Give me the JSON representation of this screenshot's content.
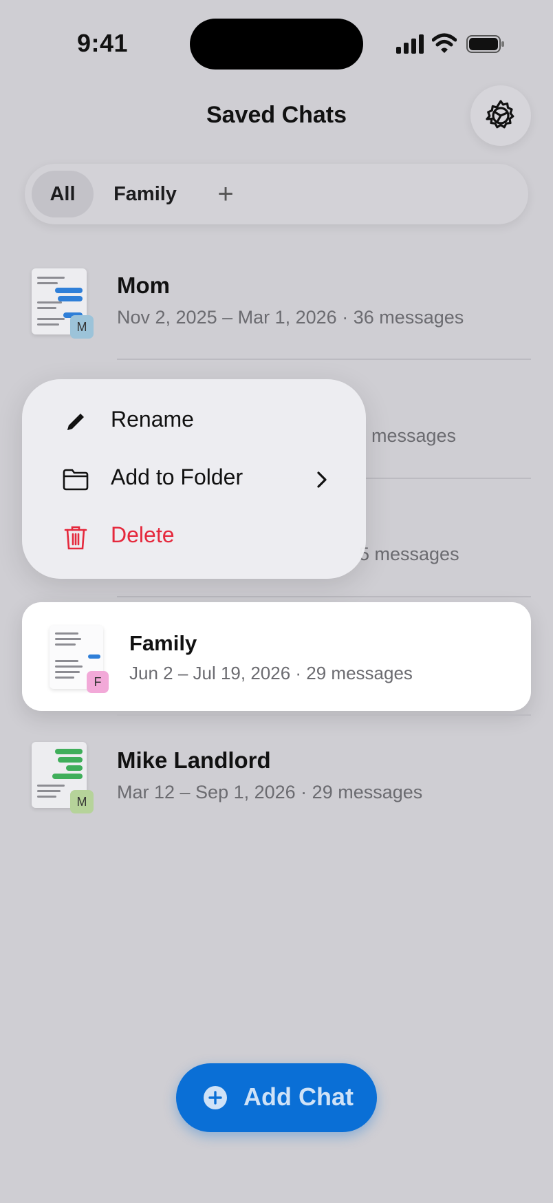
{
  "status_bar": {
    "time": "9:41"
  },
  "header": {
    "title": "Saved Chats"
  },
  "tabs": [
    {
      "label": "All",
      "selected": true
    },
    {
      "label": "Family",
      "selected": false
    },
    {
      "label": "+"
    }
  ],
  "chats": [
    {
      "name": "Mom",
      "meta": "Nov 2, 2025 – Mar 1, 2026 · 36 messages",
      "badge": "M",
      "badge_color": "#9cc3d9"
    },
    {
      "name": "",
      "meta": "messages",
      "badge": "",
      "badge_color": "#a6d39c"
    },
    {
      "name": "",
      "meta": "5 messages",
      "badge": "",
      "badge_color": "#8fb7e3"
    },
    {
      "name": "Family",
      "meta": "Jun 2 – Jul 19, 2026 · 29 messages",
      "badge": "F",
      "badge_color": "#f2a9d8"
    },
    {
      "name": "Mike Landlord",
      "meta": "Mar 12 – Sep 1, 2026 · 29 messages",
      "badge": "M",
      "badge_color": "#b6d39a"
    }
  ],
  "context_menu": {
    "items": [
      {
        "label": "Rename",
        "icon": "pencil-icon"
      },
      {
        "label": "Add to Folder",
        "icon": "folder-icon"
      },
      {
        "label": "Delete",
        "icon": "trash-icon"
      }
    ]
  },
  "add_button": {
    "label": "Add Chat"
  },
  "colors": {
    "accent": "#0a6fd6",
    "destructive": "#e5283c",
    "background": "#cfced3"
  }
}
